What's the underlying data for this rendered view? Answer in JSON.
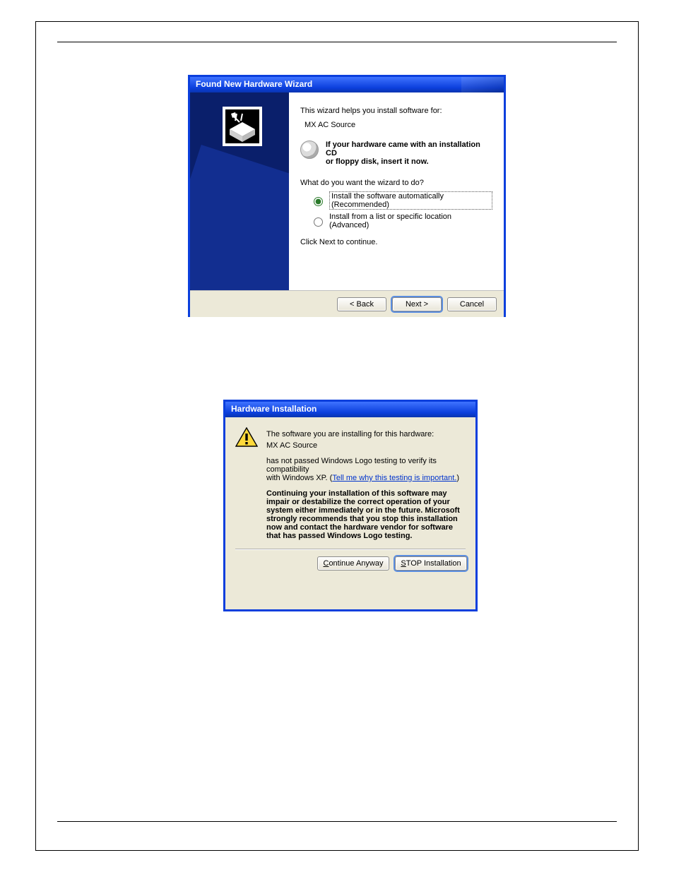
{
  "wizard": {
    "title": "Found New Hardware Wizard",
    "intro": "This wizard helps you install software for:",
    "device": "MX AC Source",
    "cd_line1": "If your hardware came with an installation CD",
    "cd_line2": "or floppy disk, insert it now.",
    "question": "What do you want the wizard to do?",
    "option_auto": "Install the software automatically (Recommended)",
    "option_list": "Install from a list or specific location (Advanced)",
    "continue_hint": "Click Next to continue.",
    "btn_back": "< Back",
    "btn_next": "Next >",
    "btn_cancel": "Cancel"
  },
  "hwinst": {
    "title": "Hardware Installation",
    "line1": "The software you are installing for this hardware:",
    "device": "MX AC Source",
    "line2a": "has not passed Windows Logo testing to verify its compatibility",
    "line2b": "with Windows XP. (",
    "link": "Tell me why this testing is important.",
    "link_close": ")",
    "warn_bold": "Continuing your installation of this software may impair or destabilize the correct operation of your system either immediately or in the future. Microsoft strongly recommends that you stop this installation now and contact the hardware vendor for software that has passed Windows Logo testing.",
    "btn_continue": "Continue Anyway",
    "btn_stop": "STOP Installation"
  }
}
